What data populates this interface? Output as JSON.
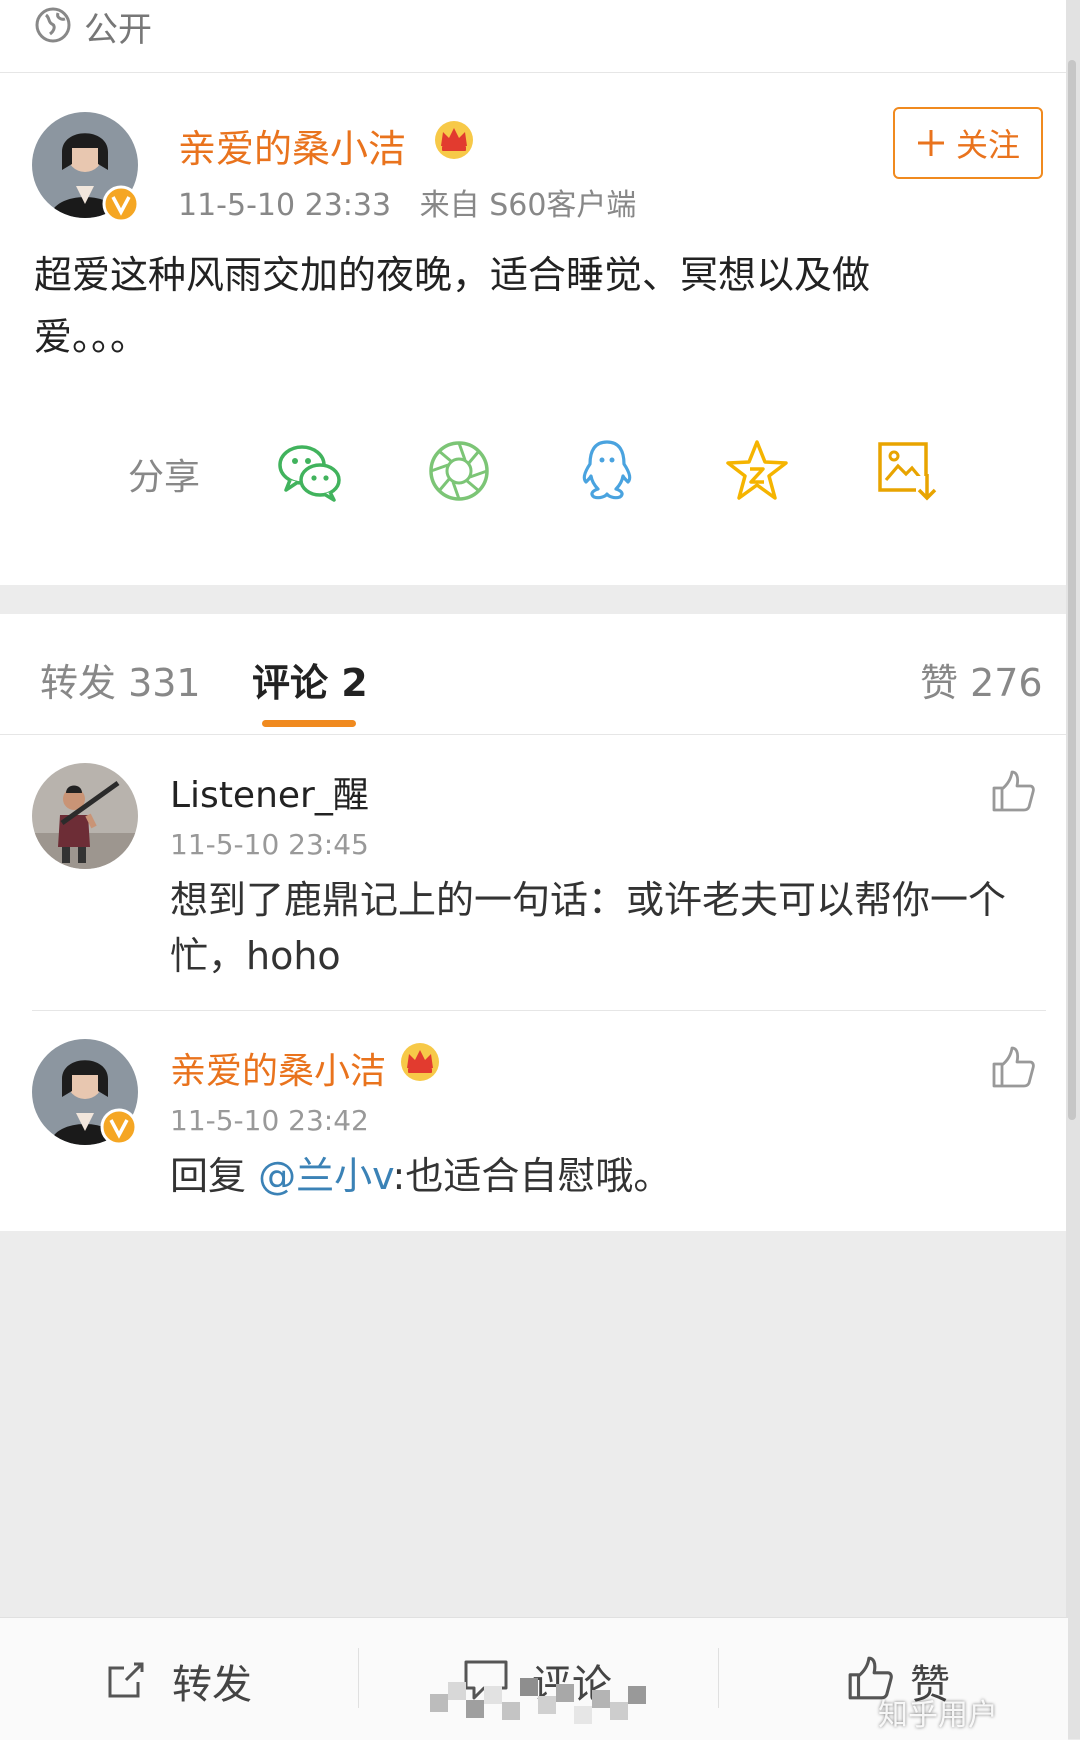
{
  "top": {
    "visibility": "公开"
  },
  "post": {
    "username": "亲爱的桑小洁",
    "meta": "11-5-10 23:33   来自 S60客户端",
    "follow_label": "关注",
    "text": "超爱这种风雨交加的夜晚，适合睡觉、冥想以及做爱。。。"
  },
  "share": {
    "label": "分享",
    "icons": [
      "wechat-icon",
      "moments-icon",
      "qq-icon",
      "favorite-icon",
      "save-image-icon"
    ]
  },
  "tabs": {
    "repost": "转发 331",
    "comments": "评论 2",
    "likes": "赞 276"
  },
  "comments": [
    {
      "name": "Listener_醒",
      "time": "11-5-10 23:45",
      "text": "想到了鹿鼎记上的一句话：或许老夫可以帮你一个忙，hoho"
    },
    {
      "name": "亲爱的桑小洁",
      "time": "11-5-10 23:42",
      "reply_prefix": "回复 ",
      "mention": "@兰小v",
      "reply_text": ":也适合自慰哦。"
    }
  ],
  "bottom_bar": {
    "repost": "转发",
    "comment": "评论",
    "like": "赞"
  },
  "watermark": "知乎用户",
  "colors": {
    "accent": "#f08a1f",
    "username": "#e9731d",
    "mention": "#3b82b6"
  }
}
